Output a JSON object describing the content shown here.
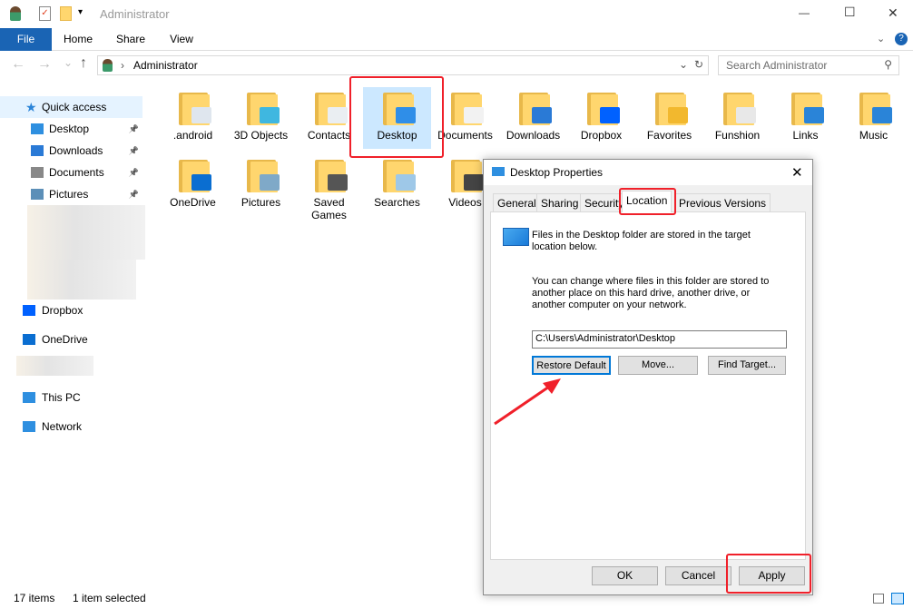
{
  "window": {
    "title": "Administrator",
    "minimize": "—",
    "maximize": "☐",
    "close": "✕"
  },
  "ribbon": {
    "tabs": [
      "File",
      "Home",
      "Share",
      "View"
    ]
  },
  "nav": {
    "back": "←",
    "forward": "→",
    "recent": "⌄",
    "up": "↑",
    "breadcrumb": "Administrator",
    "search_placeholder": "Search Administrator"
  },
  "sidebar": {
    "items": [
      {
        "label": "Quick access",
        "icon": "star-icon",
        "color": "#2a84d8"
      },
      {
        "label": "Desktop",
        "icon": "desktop-icon",
        "color": "#2e8fe0",
        "pinned": true
      },
      {
        "label": "Downloads",
        "icon": "download-icon",
        "color": "#2a7ad6",
        "pinned": true
      },
      {
        "label": "Documents",
        "icon": "document-icon",
        "color": "#888",
        "pinned": true
      },
      {
        "label": "Pictures",
        "icon": "pictures-icon",
        "color": "#5c8fb8",
        "pinned": true
      },
      {
        "label": "Dropbox",
        "icon": "dropbox-icon",
        "color": "#0061ff"
      },
      {
        "label": "OneDrive",
        "icon": "cloud-icon",
        "color": "#0a6ed1"
      },
      {
        "label": "This PC",
        "icon": "computer-icon",
        "color": "#2e8fe0"
      },
      {
        "label": "Network",
        "icon": "network-icon",
        "color": "#2e8fe0"
      }
    ]
  },
  "items": [
    {
      "label": ".android",
      "overlay": "#dfe6ee"
    },
    {
      "label": "3D Objects",
      "overlay": "#3fb7e0"
    },
    {
      "label": "Contacts",
      "overlay": "#eaeef2"
    },
    {
      "label": "Desktop",
      "overlay": "#2f8ee8",
      "selected": true
    },
    {
      "label": "Documents",
      "overlay": "#f2f2f2"
    },
    {
      "label": "Downloads",
      "overlay": "#2a7ad6"
    },
    {
      "label": "Dropbox",
      "overlay": "#0061ff"
    },
    {
      "label": "Favorites",
      "overlay": "#f2b82e"
    },
    {
      "label": "Funshion",
      "overlay": "#e8e8e8"
    },
    {
      "label": "Links",
      "overlay": "#2a84d8"
    },
    {
      "label": "Music",
      "overlay": "#2a84d8"
    },
    {
      "label": "OneDrive",
      "overlay": "#0a6ed1"
    },
    {
      "label": "Pictures",
      "overlay": "#7fa9c8"
    },
    {
      "label": "Saved Games",
      "overlay": "#555"
    },
    {
      "label": "Searches",
      "overlay": "#9ec8e8"
    },
    {
      "label": "Videos",
      "overlay": "#444"
    }
  ],
  "dialog": {
    "title": "Desktop Properties",
    "close": "✕",
    "tabs": [
      "General",
      "Sharing",
      "Security",
      "Location",
      "Previous Versions"
    ],
    "active_tab": "Location",
    "info": "Files in the Desktop folder are stored in the target location below.",
    "description": "You can change where files in this folder are stored to another place on this hard drive, another drive, or another computer on your network.",
    "path": "C:\\Users\\Administrator\\Desktop",
    "restore": "Restore Default",
    "move": "Move...",
    "find": "Find Target...",
    "ok": "OK",
    "cancel": "Cancel",
    "apply": "Apply"
  },
  "status": {
    "count": "17 items",
    "selected": "1 item selected"
  },
  "colors": {
    "annotation": "#f0202a",
    "accent": "#1a64b4"
  }
}
